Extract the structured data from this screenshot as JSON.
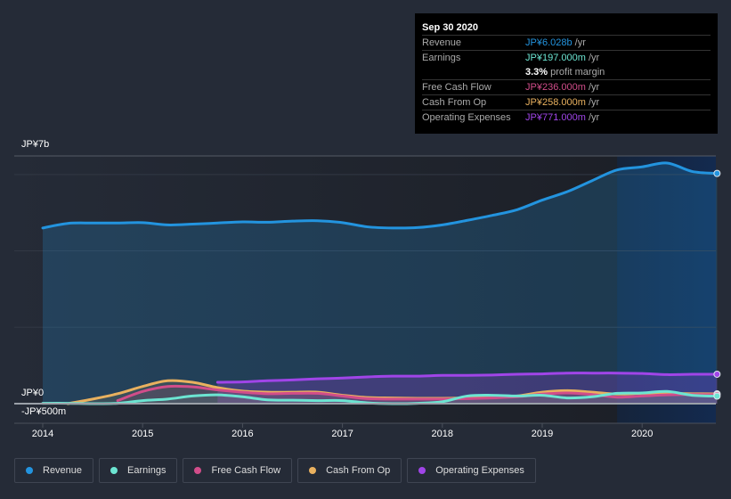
{
  "tooltip": {
    "date": "Sep 30 2020",
    "rows": [
      {
        "label": "Revenue",
        "value": "JP¥6.028b",
        "unit": " /yr",
        "color": "#2394df"
      },
      {
        "label": "Earnings",
        "value": "JP¥197.000m",
        "unit": " /yr",
        "color": "#6ce5d2"
      },
      {
        "label": "",
        "value": "3.3%",
        "unit": " profit margin",
        "color": "#ffffff"
      },
      {
        "label": "Free Cash Flow",
        "value": "JP¥236.000m",
        "unit": " /yr",
        "color": "#d14d8a"
      },
      {
        "label": "Cash From Op",
        "value": "JP¥258.000m",
        "unit": " /yr",
        "color": "#e9b15f"
      },
      {
        "label": "Operating Expenses",
        "value": "JP¥771.000m",
        "unit": " /yr",
        "color": "#a045e8"
      }
    ]
  },
  "legend": [
    {
      "label": "Revenue",
      "color": "#2394df"
    },
    {
      "label": "Earnings",
      "color": "#6ce5d2"
    },
    {
      "label": "Free Cash Flow",
      "color": "#d14d8a"
    },
    {
      "label": "Cash From Op",
      "color": "#e9b15f"
    },
    {
      "label": "Operating Expenses",
      "color": "#a045e8"
    }
  ],
  "chart_data": {
    "type": "line",
    "title": "",
    "xlabel": "",
    "ylabel": "",
    "y_tick_labels": [
      "JP¥7b",
      "JP¥0",
      "-JP¥500m"
    ],
    "x_tick_labels": [
      "2014",
      "2015",
      "2016",
      "2017",
      "2018",
      "2019",
      "2020"
    ],
    "ylim": [
      -0.5,
      6.5
    ],
    "y_units": "JP¥ billions",
    "xlim": [
      2013.7,
      2020.75
    ],
    "highlight_from": 2019.75,
    "grid": true,
    "legend_position": "bottom",
    "series": [
      {
        "name": "Revenue",
        "color": "#2394df",
        "x": [
          2014.0,
          2014.25,
          2014.5,
          2014.75,
          2015.0,
          2015.25,
          2015.5,
          2015.75,
          2016.0,
          2016.25,
          2016.5,
          2016.75,
          2017.0,
          2017.25,
          2017.5,
          2017.75,
          2018.0,
          2018.25,
          2018.5,
          2018.75,
          2019.0,
          2019.25,
          2019.5,
          2019.75,
          2020.0,
          2020.25,
          2020.5,
          2020.75
        ],
        "y": [
          4.6,
          4.72,
          4.73,
          4.73,
          4.74,
          4.68,
          4.7,
          4.73,
          4.76,
          4.75,
          4.78,
          4.79,
          4.74,
          4.63,
          4.6,
          4.61,
          4.68,
          4.8,
          4.93,
          5.08,
          5.33,
          5.55,
          5.84,
          6.12,
          6.2,
          6.3,
          6.08,
          6.028
        ]
      },
      {
        "name": "Earnings",
        "color": "#6ce5d2",
        "x": [
          2014.0,
          2014.25,
          2014.5,
          2014.75,
          2015.0,
          2015.25,
          2015.5,
          2015.75,
          2016.0,
          2016.25,
          2016.5,
          2016.75,
          2017.0,
          2017.25,
          2017.5,
          2017.75,
          2018.0,
          2018.25,
          2018.5,
          2018.75,
          2019.0,
          2019.25,
          2019.5,
          2019.75,
          2020.0,
          2020.25,
          2020.5,
          2020.75
        ],
        "y": [
          0.01,
          0.01,
          0.0,
          0.01,
          0.08,
          0.12,
          0.2,
          0.23,
          0.18,
          0.1,
          0.09,
          0.08,
          0.08,
          0.02,
          0.0,
          0.01,
          0.05,
          0.2,
          0.22,
          0.2,
          0.22,
          0.15,
          0.18,
          0.27,
          0.28,
          0.32,
          0.22,
          0.197
        ]
      },
      {
        "name": "Free Cash Flow",
        "color": "#d14d8a",
        "x": [
          2014.75,
          2015.0,
          2015.25,
          2015.5,
          2015.75,
          2016.0,
          2016.25,
          2016.5,
          2016.75,
          2017.0,
          2017.25,
          2017.5,
          2017.75,
          2018.0,
          2018.25,
          2018.5,
          2018.75,
          2019.0,
          2019.25,
          2019.5,
          2019.75,
          2020.0,
          2020.25,
          2020.5,
          2020.75
        ],
        "y": [
          0.08,
          0.32,
          0.45,
          0.44,
          0.36,
          0.3,
          0.26,
          0.27,
          0.27,
          0.2,
          0.13,
          0.12,
          0.12,
          0.12,
          0.13,
          0.15,
          0.18,
          0.25,
          0.28,
          0.24,
          0.17,
          0.2,
          0.23,
          0.24,
          0.236
        ]
      },
      {
        "name": "Cash From Op",
        "color": "#e9b15f",
        "x": [
          2014.25,
          2014.5,
          2014.75,
          2015.0,
          2015.25,
          2015.5,
          2015.75,
          2016.0,
          2016.25,
          2016.5,
          2016.75,
          2017.0,
          2017.25,
          2017.5,
          2017.75,
          2018.0,
          2018.25,
          2018.5,
          2018.75,
          2019.0,
          2019.25,
          2019.5,
          2019.75,
          2020.0,
          2020.25,
          2020.5,
          2020.75
        ],
        "y": [
          0.0,
          0.12,
          0.26,
          0.45,
          0.6,
          0.56,
          0.42,
          0.33,
          0.3,
          0.3,
          0.3,
          0.22,
          0.16,
          0.15,
          0.14,
          0.14,
          0.15,
          0.17,
          0.2,
          0.3,
          0.34,
          0.3,
          0.25,
          0.27,
          0.27,
          0.26,
          0.258
        ]
      },
      {
        "name": "Operating Expenses",
        "color": "#a045e8",
        "x": [
          2015.75,
          2016.0,
          2016.25,
          2016.5,
          2016.75,
          2017.0,
          2017.25,
          2017.5,
          2017.75,
          2018.0,
          2018.25,
          2018.5,
          2018.75,
          2019.0,
          2019.25,
          2019.5,
          2019.75,
          2020.0,
          2020.25,
          2020.5,
          2020.75
        ],
        "y": [
          0.56,
          0.57,
          0.6,
          0.62,
          0.65,
          0.67,
          0.7,
          0.72,
          0.72,
          0.74,
          0.74,
          0.75,
          0.77,
          0.78,
          0.8,
          0.8,
          0.8,
          0.79,
          0.76,
          0.77,
          0.771
        ]
      }
    ]
  }
}
